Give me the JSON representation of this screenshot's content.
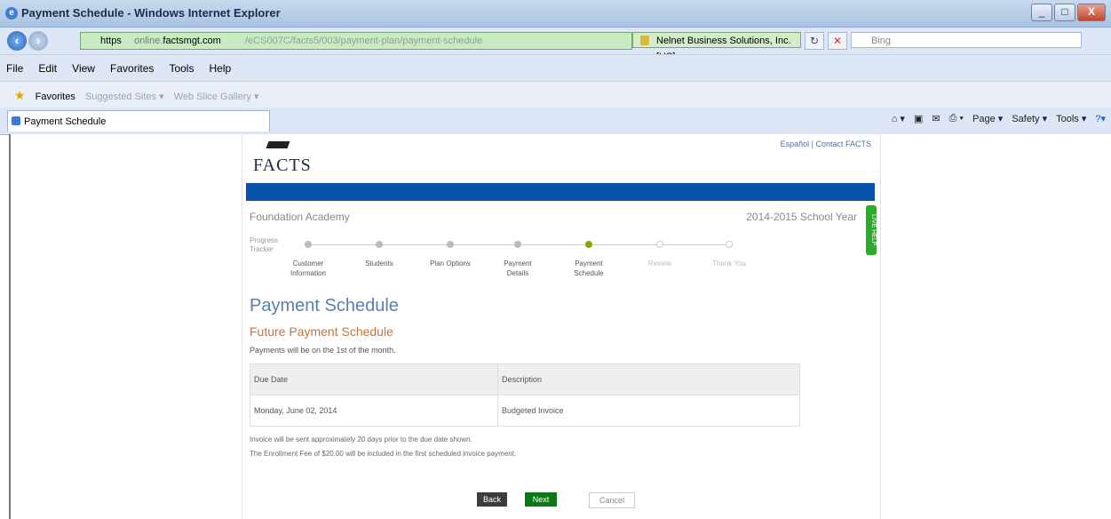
{
  "window": {
    "title": "Payment Schedule - Windows Internet Explorer",
    "min": "_",
    "max": "□",
    "close": "X"
  },
  "address": {
    "proto": "https",
    "host_pre": "online.",
    "host_main": "factsmgt.com",
    "path": "/eCS007C/facts5/003/payment-plan/payment-schedule",
    "cert": "Nelnet Business Solutions, Inc. [US]",
    "search_placeholder": "Bing"
  },
  "menu": [
    "File",
    "Edit",
    "View",
    "Favorites",
    "Tools",
    "Help"
  ],
  "favorites": {
    "label": "Favorites",
    "suggested": "Suggested Sites ▾",
    "gallery": "Web Slice Gallery ▾"
  },
  "tab": {
    "label": "Payment Schedule"
  },
  "commands": [
    "Page ▾",
    "Safety ▾",
    "Tools ▾"
  ],
  "page": {
    "logo": "FACTS",
    "toplinks": "Español  |  Contact FACTS",
    "school": "Foundation Academy",
    "year": "2014-2015 School Year",
    "sidetab": "LIVE HELP",
    "tracker_label": "Progress\nTracker",
    "steps": [
      {
        "label": "Customer Information",
        "state": "done"
      },
      {
        "label": "Students",
        "state": "done"
      },
      {
        "label": "Plan Options",
        "state": "done"
      },
      {
        "label": "Payment Details",
        "state": "done"
      },
      {
        "label": "Payment Schedule",
        "state": "active"
      },
      {
        "label": "Review",
        "state": "todo"
      },
      {
        "label": "Thank You",
        "state": "todo"
      }
    ],
    "heading": "Payment Schedule",
    "subheading": "Future Payment Schedule",
    "note": "Payments will be on the 1st of the month.",
    "table": {
      "headers": [
        "Due Date",
        "Description"
      ],
      "rows": [
        [
          "Monday, June 02, 2014",
          "Budgeted Invoice"
        ]
      ]
    },
    "foot1": "Invoice will be sent approximately 20 days prior to the due date shown.",
    "foot2": "The Enrollment Fee of $20.00 will be included in the first scheduled invoice payment.",
    "buttons": {
      "back": "Back",
      "next": "Next",
      "cancel": "Cancel"
    }
  }
}
